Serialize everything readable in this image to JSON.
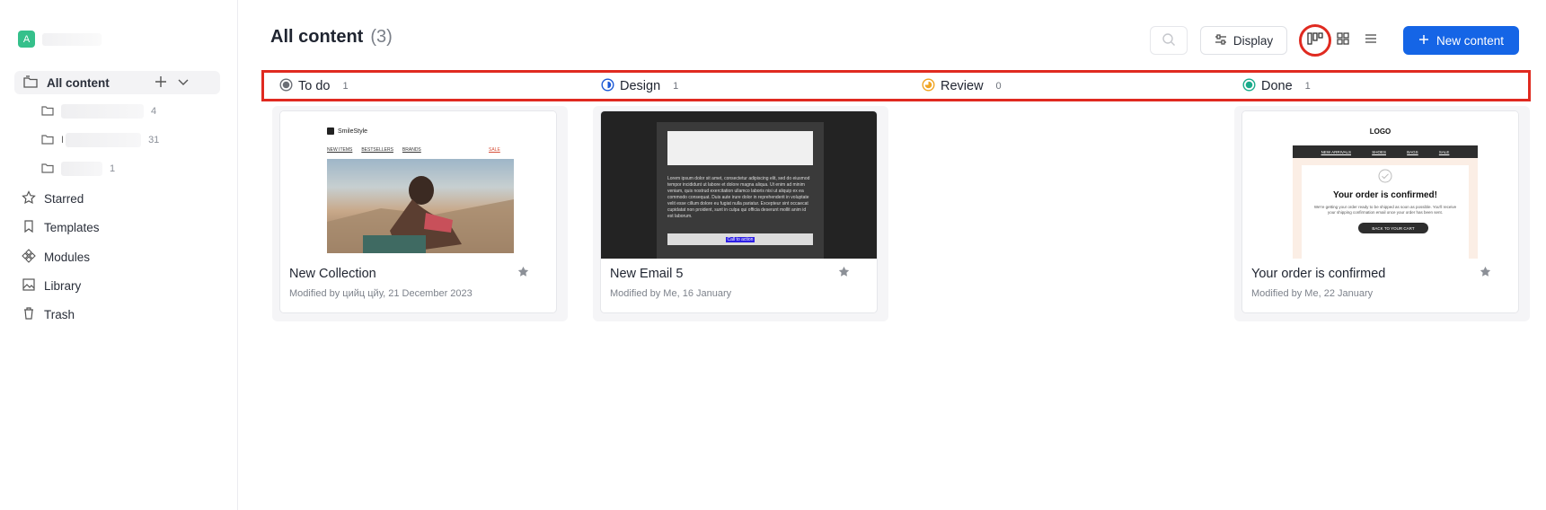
{
  "sidebar": {
    "workspace_initial": "A",
    "all_content_label": "All content",
    "folders": [
      {
        "count": "4"
      },
      {
        "prefix": "I",
        "count": "31"
      },
      {
        "count": "1"
      }
    ],
    "items": [
      {
        "label": "Starred",
        "icon": "star-icon"
      },
      {
        "label": "Templates",
        "icon": "bookmark-icon"
      },
      {
        "label": "Modules",
        "icon": "modules-icon"
      },
      {
        "label": "Library",
        "icon": "image-icon"
      },
      {
        "label": "Trash",
        "icon": "trash-icon"
      }
    ]
  },
  "header": {
    "title": "All content",
    "count": "(3)",
    "display_label": "Display",
    "new_content_label": "New content"
  },
  "statuses": [
    {
      "label": "To do",
      "count": "1",
      "color": "#6b6f76"
    },
    {
      "label": "Design",
      "count": "1",
      "color": "#1c59d6"
    },
    {
      "label": "Review",
      "count": "0",
      "color": "#f0a422"
    },
    {
      "label": "Done",
      "count": "1",
      "color": "#1aab8b"
    }
  ],
  "cards": [
    {
      "title": "New Collection",
      "meta": "Modified by цийц цйу, 21 December 2023",
      "thumb": {
        "brand": "SmileStyle",
        "nav": [
          "NEW ITEMS",
          "BESTSELLERS",
          "BRANDS"
        ],
        "sale": "SALE"
      }
    },
    {
      "title": "New Email 5",
      "meta": "Modified by Me, 16 January",
      "thumb": {
        "body": "Lorem ipsum dolor sit amet, consectetur adipiscing elit, sed do eiusmod tempor incididunt ut labore et dolore magna aliqua. Ut enim ad minim veniam, quis nostrud exercitation ullamco laboris nisi ut aliquip ex ea commodo consequat. Duis aute irure dolor in reprehenderit in voluptate velit esse cillum dolore eu fugiat nulla pariatur. Excepteur sint occaecat cupidatat non proident, sunt in culpa qui officia deserunt mollit anim id est laborum.",
        "cta": "Call to action"
      }
    },
    {
      "title": "Your order is confirmed",
      "meta": "Modified by Me, 22 January",
      "thumb": {
        "logo": "LOGO",
        "nav": [
          "NEW ARRIVALS",
          "SHOES",
          "BAGS",
          "SALE"
        ],
        "heading": "Your order is confirmed!",
        "body": "We're getting your order ready to be shipped as soon as possible. You'll receive your shipping confirmation email once your order has been sent.",
        "cta": "BACK TO YOUR CART"
      }
    }
  ]
}
